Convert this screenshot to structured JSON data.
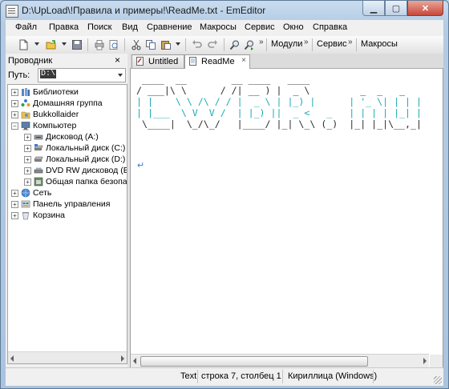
{
  "window": {
    "title": "D:\\UpLoad\\!Правила и примеры!\\ReadMe.txt - EmEditor"
  },
  "menu": [
    "Файл",
    "Правка",
    "Поиск",
    "Вид",
    "Сравнение",
    "Макросы",
    "Сервис",
    "Окно",
    "Справка"
  ],
  "toolbar": {
    "modules_label": "Модули",
    "service_label": "Сервис",
    "macros_label": "Макросы",
    "chevron": "»"
  },
  "explorer": {
    "title": "Проводник",
    "close_glyph": "×",
    "path_label": "Путь:",
    "path_value": "D:\\",
    "tree": [
      {
        "label": "Библиотеки",
        "icon": "libraries-icon"
      },
      {
        "label": "Домашняя группа",
        "icon": "homegroup-icon"
      },
      {
        "label": "Bukkollaider",
        "icon": "user-folder-icon"
      },
      {
        "label": "Компьютер",
        "icon": "computer-icon"
      },
      {
        "label": "Дисковод (A:)",
        "icon": "floppy-drive-icon"
      },
      {
        "label": "Локальный диск (C:)",
        "icon": "hard-drive-icon"
      },
      {
        "label": "Локальный диск (D:)",
        "icon": "hard-drive-icon"
      },
      {
        "label": "DVD RW дисковод (E:)",
        "icon": "dvd-drive-icon"
      },
      {
        "label": "Общая папка безопас",
        "icon": "shared-folder-icon"
      },
      {
        "label": "Сеть",
        "icon": "network-icon"
      },
      {
        "label": "Панель управления",
        "icon": "control-panel-icon"
      },
      {
        "label": "Корзина",
        "icon": "recycle-bin-icon"
      }
    ]
  },
  "tabs": [
    {
      "label": "Untitled"
    },
    {
      "label": "ReadMe",
      "close": "×"
    }
  ],
  "editor": {
    "lines": [
      " ____  __        __ ____   ____",
      "/ ___|\\ \\      / /| __ ) |  _ \\         _  _   _",
      "| |    \\ \\ /\\ / / |  _ \\ | |_) |      | '_ \\| | | |",
      "| |___  \\ V  V /  | |_) ||  _ <   _   | | | | |_| |",
      " \\____|  \\_/\\_/   |____/ |_| \\_\\ (_)  |_| |_|\\__,_|"
    ],
    "eol_mark": "↵"
  },
  "statusbar": {
    "mode": "Text",
    "position": "строка 7, столбец 1",
    "encoding": "Кириллица (Windows)"
  },
  "colors": {
    "ascii_cyan": "#1ba9b5",
    "ascii_dark": "#2b2b2b",
    "eol_blue": "#3e7ccf"
  }
}
